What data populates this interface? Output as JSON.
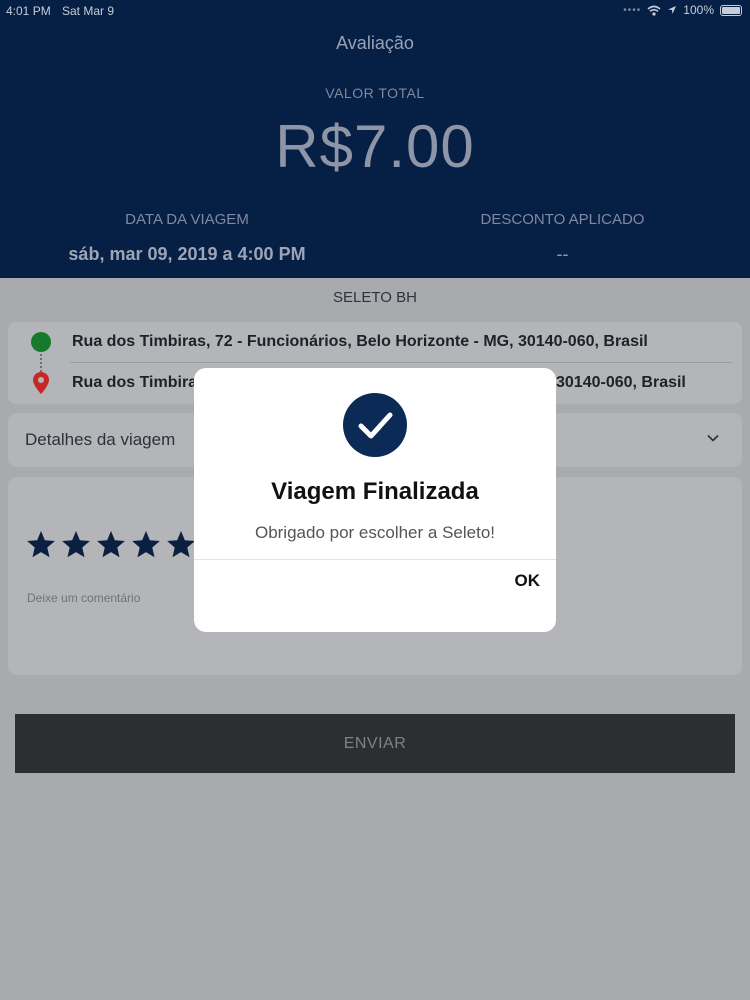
{
  "status_bar": {
    "time": "4:01 PM",
    "date": "Sat Mar 9",
    "battery": "100%"
  },
  "header": {
    "title": "Avaliação",
    "total_label": "VALOR TOTAL",
    "total_value": "R$7.00",
    "date_label": "DATA DA VIAGEM",
    "date_value": "sáb, mar 09, 2019 a 4:00 PM",
    "discount_label": "DESCONTO APLICADO",
    "discount_value": "--"
  },
  "company": "SELETO BH",
  "route": {
    "origin": "Rua dos Timbiras,  72 - Funcionários,  Belo Horizonte - MG,  30140-060,  Brasil",
    "destination_left": "Rua dos Timbiras",
    "destination_right": "30140-060,  Brasil"
  },
  "details": {
    "label": "Detalhes da viagem"
  },
  "rating": {
    "stars": 5,
    "comment_placeholder": "Deixe um comentário"
  },
  "send_button": "ENVIAR",
  "modal": {
    "title": "Viagem Finalizada",
    "message": "Obrigado por escolher a Seleto!",
    "ok": "OK"
  },
  "colors": {
    "header_bg": "#061f45",
    "origin_marker": "#157a2e",
    "destination_marker": "#c62828",
    "star": "#0b2040",
    "check_circle": "#0b2a55"
  }
}
